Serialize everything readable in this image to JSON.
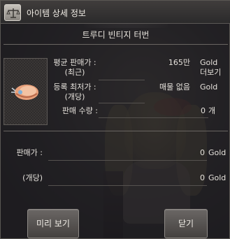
{
  "window": {
    "title": "아이템 상세 정보"
  },
  "item": {
    "name": "트루디 빈티지 터번",
    "icon": "turban-icon"
  },
  "rows": [
    {
      "label": "평균 판매가 :",
      "sublabel": "(최근)",
      "value": "165만",
      "unit": "Gold",
      "unit_sub": "더보기"
    },
    {
      "label": "등록 최저가 :",
      "sublabel": "(개당)",
      "value": "매물 없음",
      "unit": "Gold"
    },
    {
      "label": "판매 수량 :",
      "value": "0",
      "unit": "개"
    }
  ],
  "sell": {
    "price_label": "판매가 :",
    "price_value": "0",
    "price_unit": "Gold",
    "each_label": "(개당)",
    "each_value": "0",
    "each_unit": "Gold"
  },
  "buttons": {
    "preview": "미리 보기",
    "close": "닫기"
  }
}
